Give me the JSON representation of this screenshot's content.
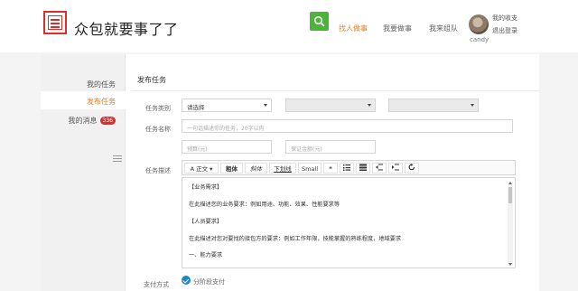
{
  "header": {
    "brand": "众包就要事了了",
    "nav": [
      "找人做事",
      "我要做事",
      "我来组队"
    ],
    "user_links": [
      "我的收支",
      "退出登录"
    ],
    "username": "candy"
  },
  "sidebar": {
    "items": [
      "我的任务",
      "发布任务",
      "我的消息"
    ],
    "badge": "336"
  },
  "form": {
    "section_title": "发布任务",
    "labels": {
      "category": "任务类别",
      "name": "任务名称",
      "description": "任务描述",
      "payment": "支付方式"
    },
    "category_select": "请选择",
    "name_placeholder": "一句话描述你的任务，20字以内",
    "budget_placeholder": "预算(元)",
    "money_placeholder": "保证金额(元)",
    "toolbar": {
      "font": "A 正文",
      "bold": "粗体",
      "italic": "斜体",
      "underline": "下划线",
      "small": "Small",
      "quote": "❝"
    },
    "editor_lines": [
      "【业务需求】",
      "在此描述您的业务要求：例如用途、功能、效果、性能要求等",
      "【人员要求】",
      "在此描述对您对要找的接包方的要求：例如工作年限，技能掌握的熟练程度，地域要求",
      "一、能力要求"
    ],
    "payment_option": "分阶段支付"
  },
  "colors": {
    "accent": "#e67e22",
    "search_green": "#4eb33b",
    "badge_red": "#d9302b",
    "check_blue": "#1f87c7"
  }
}
